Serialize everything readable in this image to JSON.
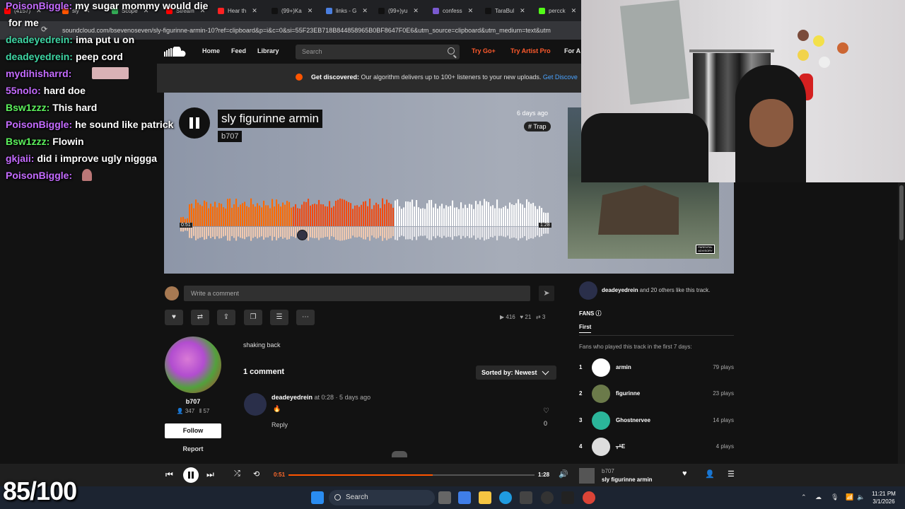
{
  "browser": {
    "tabs": [
      {
        "label": "(4157)",
        "color": "#ff0000"
      },
      {
        "label": "sly",
        "color": "#ff5500"
      },
      {
        "label": "Scope",
        "color": "#33aa55"
      },
      {
        "label": "Stream",
        "color": "#ff0000"
      },
      {
        "label": "Hear th",
        "color": "#ff2222"
      },
      {
        "label": "(99+)Ka",
        "color": "#111111"
      },
      {
        "label": "links - G",
        "color": "#4a7fe0"
      },
      {
        "label": "(99+)yu",
        "color": "#111111"
      },
      {
        "label": "confess",
        "color": "#7a5ad0"
      },
      {
        "label": "TaraBul",
        "color": "#111111"
      },
      {
        "label": "percck",
        "color": "#53fc18"
      }
    ],
    "url": "soundcloud.com/bsevenoseven/sly-figurinne-armin-10?ref=clipboard&p=i&c=0&si=55F23EB718B844858965B0BF8647F0E6&utm_source=clipboard&utm_medium=text&utm"
  },
  "nav": {
    "home": "Home",
    "feed": "Feed",
    "library": "Library",
    "search_placeholder": "Search",
    "try_go": "Try Go+",
    "try_artist": "Try Artist Pro",
    "for_artists": "For A"
  },
  "banner": {
    "bold": "Get discovered:",
    "text": " Our algorithm delivers up to 100+ listeners to your new uploads.",
    "link": " Get Discove"
  },
  "track": {
    "title": "sly figurinne armin",
    "artist": "b707",
    "posted": "6 days ago",
    "tag": "# Trap",
    "current_time": "0:51",
    "duration": "1:28",
    "progress": 0.58,
    "art_label": "PARENTAL ADVISORY"
  },
  "comment_input": {
    "placeholder": "Write a comment"
  },
  "actions": {
    "like": "♥",
    "repost": "⇄",
    "share": "⇪",
    "copy": "❐",
    "playlist": "☰",
    "more": "⋯"
  },
  "stats": {
    "plays": "▶ 416",
    "likes": "♥ 21",
    "reposts": "⇄ 3"
  },
  "artist_card": {
    "name": "b707",
    "followers": "👤 347",
    "tracks": "⫴ 57",
    "follow": "Follow",
    "report": "Report"
  },
  "description": "shaking back",
  "comments": {
    "count": "1 comment",
    "sort": "Sorted by: Newest",
    "items": [
      {
        "user": "deadeyedrein",
        "at": " at 0:28",
        "ago": " · 5 days ago",
        "body": "🔥",
        "reply": "Reply",
        "likes": "0"
      }
    ]
  },
  "sidebar": {
    "likers_name": "deadeyedrein",
    "likers_text": " and 20 others like this track.",
    "fans_label": "FANS ⓘ",
    "tab_first": "First",
    "note": "Fans who played this track in the first 7 days:",
    "fans": [
      {
        "rank": "1",
        "name": "armin",
        "plays": "79 plays",
        "color": "#ffffff"
      },
      {
        "rank": "2",
        "name": "figurinne",
        "plays": "23 plays",
        "color": "#6b7a4a"
      },
      {
        "rank": "3",
        "name": "Ghostnervee",
        "plays": "14 plays",
        "color": "#2bb59a"
      },
      {
        "rank": "4",
        "name": "ᚁᚆE",
        "plays": "4 plays",
        "color": "#dddddd"
      }
    ]
  },
  "player": {
    "current": "0:51",
    "duration": "1:28",
    "artist": "b707",
    "title": "sly figurinne armin"
  },
  "chat": [
    {
      "user": "PoisonBiggle:",
      "msg": "my sugar mommy would die",
      "color": "#c46bff"
    },
    {
      "user": "",
      "msg": "for me",
      "color": "#ffffff"
    },
    {
      "user": "deadeyedrein:",
      "msg": "ima put u on",
      "color": "#3fd6a4"
    },
    {
      "user": "deadeyedrein:",
      "msg": "peep cord",
      "color": "#3fd6a4"
    },
    {
      "user": "mydihisharrd:",
      "msg": "",
      "color": "#c46bff"
    },
    {
      "user": "55nolo:",
      "msg": "hard doe",
      "color": "#c46bff"
    },
    {
      "user": "Bsw1zzz:",
      "msg": "This hard",
      "color": "#5cf25c"
    },
    {
      "user": "PoisonBiggle:",
      "msg": "he sound like patrick",
      "color": "#c46bff"
    },
    {
      "user": "Bsw1zzz:",
      "msg": "Flowin",
      "color": "#5cf25c"
    },
    {
      "user": "gkjaii:",
      "msg": "did i improve ugly niggga",
      "color": "#c46bff"
    },
    {
      "user": "PoisonBiggle:",
      "msg": "",
      "color": "#c46bff"
    }
  ],
  "score": "85/100",
  "taskbar": {
    "search": "Search",
    "time": "11:21 PM",
    "date": "3/1/2026"
  },
  "colors": {
    "accent": "#ff5500",
    "background": "#121212"
  }
}
